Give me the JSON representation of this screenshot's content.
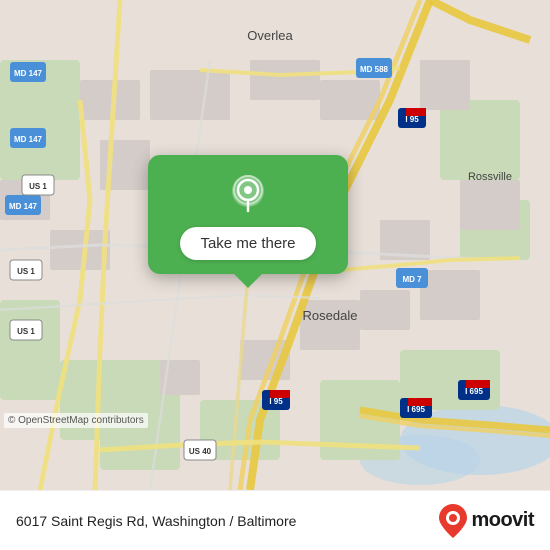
{
  "map": {
    "attribution": "© OpenStreetMap contributors",
    "background_color": "#e8e0d8"
  },
  "tooltip": {
    "button_label": "Take me there"
  },
  "footer": {
    "address": "6017 Saint Regis Rd, Washington / Baltimore"
  },
  "moovit": {
    "wordmark": "moovit"
  },
  "road_labels": {
    "md147_1": "MD 147",
    "md147_2": "MD 147",
    "md147_3": "MD 147",
    "us1_1": "US 1",
    "us1_2": "US 1",
    "us1_3": "US 1",
    "md588": "MD 588",
    "i95_1": "I 95",
    "i95_2": "I 95",
    "i695_1": "I 695",
    "i695_2": "I 695",
    "md7": "MD 7",
    "us40": "US 40",
    "overlea": "Overlea",
    "rossville": "Rossville",
    "rosedale": "Rosedale"
  }
}
